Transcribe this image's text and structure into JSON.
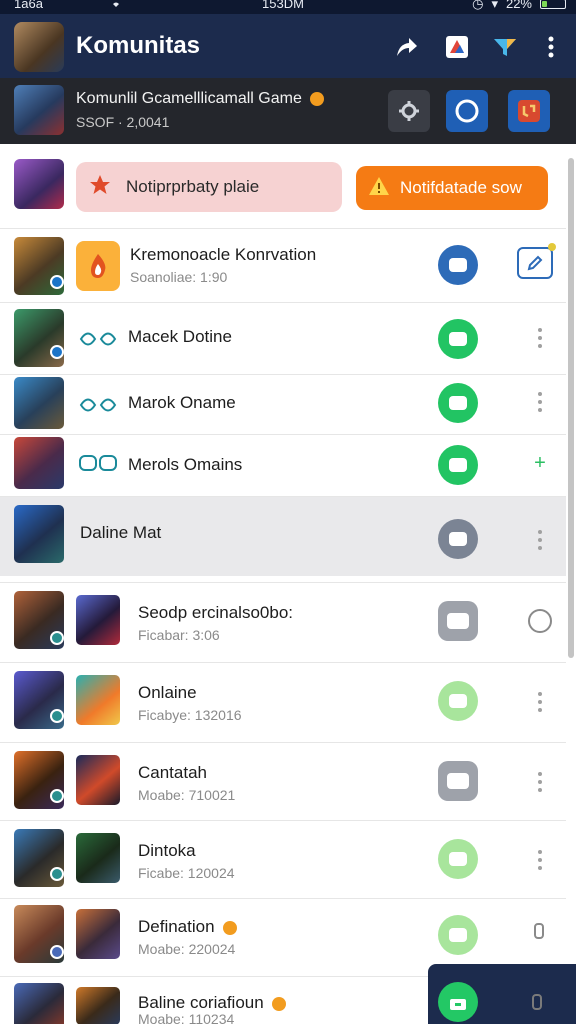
{
  "status_bar": {
    "left": "1a6a",
    "center": "153DM",
    "battery": "22%"
  },
  "app_bar": {
    "title": "Komunitas",
    "actions": [
      "share-icon",
      "app-icon",
      "filter-icon",
      "more-vertical-icon"
    ]
  },
  "game_bar": {
    "name": "Komunlil Gcamelllicamall Game",
    "subtitle": "SSOF · 2,0041",
    "buttons": [
      "search-icon",
      "circle-icon",
      "badge-icon"
    ]
  },
  "notification": {
    "pink_label": "Notiprprbaty plaie",
    "orange_label": "Notifdatade sow"
  },
  "rows": [
    {
      "name": "Kremonoacle Konrvation",
      "sub": "Soanoliae: 1:90",
      "btn_color": "#2d6bb8"
    },
    {
      "name": "Macek Dotine",
      "sub": "",
      "btn_color": "#22c463"
    },
    {
      "name": "Marok Oname",
      "sub": "",
      "btn_color": "#22c463"
    },
    {
      "name": "Merols Omains",
      "sub": "",
      "btn_color": "#22c463"
    },
    {
      "name": "Daline Mat",
      "sub": "",
      "btn_color": "#7b8494"
    },
    {
      "name": "Seodp ercinalso0bo:",
      "sub": "Ficabar: 3:06",
      "btn_color": "#9ea2aa"
    },
    {
      "name": "Onlaine",
      "sub": "Ficabye: 132016",
      "btn_color": "#a8e59c"
    },
    {
      "name": "Cantatah",
      "sub": "Moabe: 710021",
      "btn_color": "#9ea2aa"
    },
    {
      "name": "Dintoka",
      "sub": "Ficabe: 120024",
      "btn_color": "#a8e59c"
    },
    {
      "name": "Defination",
      "sub": "Moabe: 220024",
      "btn_color": "#a8e59c"
    },
    {
      "name": "Baline coriafioun",
      "sub": "Moabe: 110234",
      "btn_color": "#a8e59c"
    }
  ],
  "colors": {
    "appbar": "#1c2b4d",
    "gamebar": "#24262c",
    "accent_green": "#22c463",
    "accent_orange": "#f57b14"
  }
}
